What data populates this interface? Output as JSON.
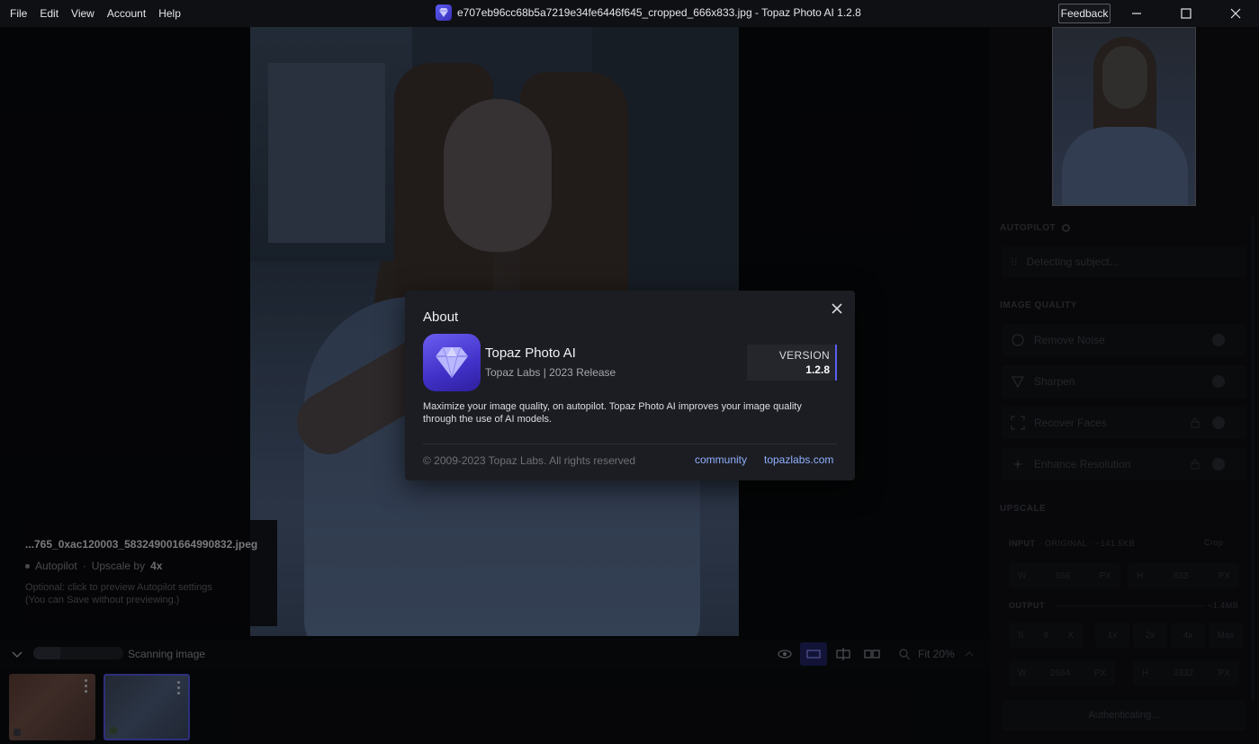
{
  "menu": [
    "File",
    "Edit",
    "View",
    "Account",
    "Help"
  ],
  "window": {
    "title": "e707eb96cc68b5a7219e34fe6446f645_cropped_666x833.jpg - Topaz Photo AI 1.2.8",
    "feedback_label": "Feedback"
  },
  "info_overlay": {
    "filename": "...765_0xac120003_583249001664990832.jpeg",
    "autopilot_label": "Autopilot",
    "separator": "·",
    "upscale_prefix": "Upscale by",
    "upscale_value": "4x",
    "hint_line1": "Optional: click to preview Autopilot settings",
    "hint_line2": "(You can Save without previewing.)"
  },
  "bottombar": {
    "progress_fraction": 0.3,
    "status_text": "Scanning image",
    "zoom_label": "Fit 20%"
  },
  "right_panel": {
    "autopilot_title": "AUTOPILOT",
    "detecting_text": "Detecting subject...",
    "image_quality_title": "IMAGE QUALITY",
    "filters": [
      {
        "label": "Remove Noise",
        "icon": "noise-icon"
      },
      {
        "label": "Sharpen",
        "icon": "sharpen-icon"
      },
      {
        "label": "Recover Faces",
        "icon": "face-icon"
      },
      {
        "label": "Enhance Resolution",
        "icon": "sparkle-icon"
      }
    ],
    "upscale_title": "UPSCALE",
    "input_label": "INPUT",
    "input_meta": "· ORIGINAL · ~141.5KB",
    "crop_label": "Crop",
    "input_w_label": "W",
    "input_w_value": "666",
    "input_h_label": "H",
    "input_h_value": "833",
    "unit": "PX",
    "output_label": "OUTPUT",
    "output_size": "~1.4MB",
    "scale_label": "S",
    "scale_value": "4",
    "scale_x": "X",
    "presets": [
      "1x",
      "2x",
      "4x",
      "Max"
    ],
    "output_w_label": "W",
    "output_w_value": "2664",
    "output_h_label": "H",
    "output_h_value": "3332",
    "auth_text": "Authenticating..."
  },
  "about_dialog": {
    "title": "About",
    "product_name": "Topaz Photo AI",
    "product_meta": "Topaz Labs | 2023 Release",
    "version_label": "VERSION",
    "version_number": "1.2.8",
    "description": "Maximize your image quality, on autopilot. Topaz Photo AI improves your image quality through the use of AI models.",
    "copyright": "© 2009-2023 Topaz Labs. All rights reserved",
    "community_link": "community",
    "website_link": "topazlabs.com"
  },
  "colors": {
    "accent": "#4f52d6",
    "link": "#8fb0ff",
    "dialog_bg": "#1c1d22"
  }
}
